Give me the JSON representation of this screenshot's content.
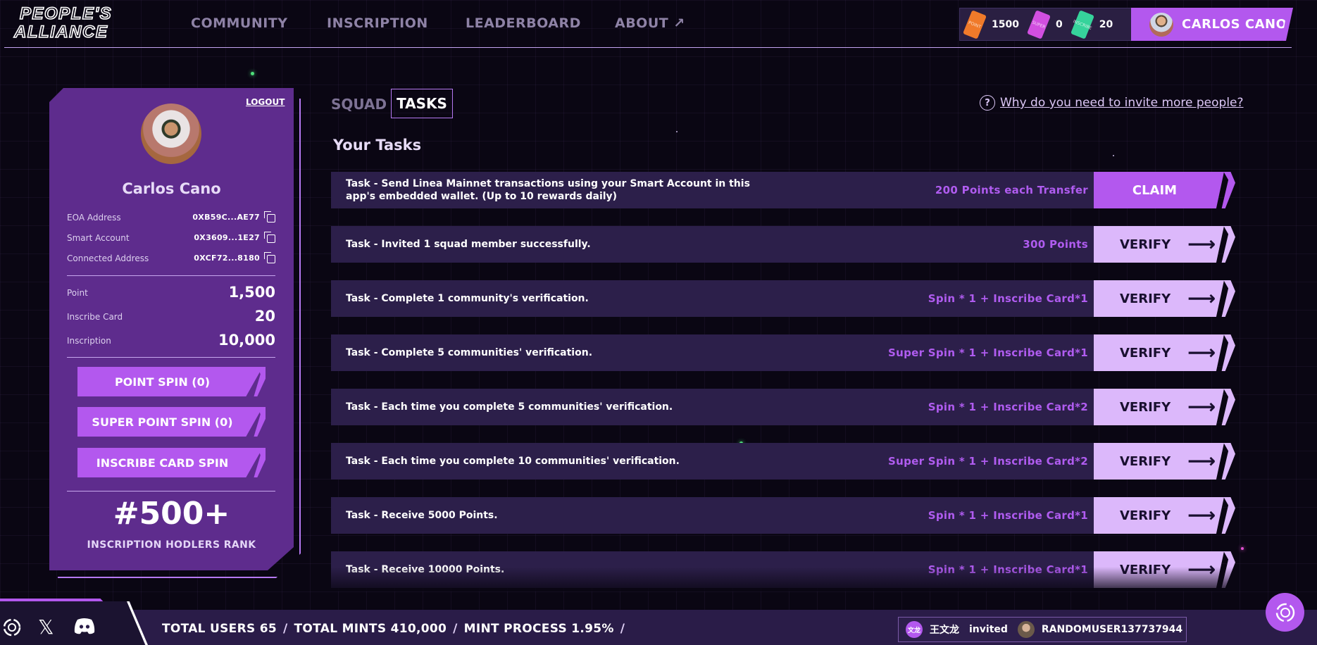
{
  "brand": {
    "logo_line1": "PEOPLE'S",
    "logo_line2": "ALLIANCE"
  },
  "nav": {
    "community": "COMMUNITY",
    "inscription": "INSCRIPTION",
    "leaderboard": "LEADERBOARD",
    "about": "ABOUT ↗"
  },
  "header_stats": {
    "point": {
      "icon": "point-ticket-icon",
      "ticket_label": "POINT",
      "value": "1500",
      "color": "#f07a2a"
    },
    "super": {
      "icon": "super-ticket-icon",
      "ticket_label": "SUPER",
      "value": "0",
      "color": "#d14fe0"
    },
    "inscribe": {
      "icon": "inscribe-ticket-icon",
      "ticket_label": "INSCRIBE",
      "value": "20",
      "color": "#36d39b"
    }
  },
  "user": {
    "name_upper": "CARLOS CANO",
    "name": "Carlos Cano"
  },
  "profile": {
    "logout": "LOGOUT",
    "addresses": [
      {
        "label": "EOA Address",
        "value": "0XB59C...AE77"
      },
      {
        "label": "Smart Account",
        "value": "0X3609...1E27"
      },
      {
        "label": "Connected Address",
        "value": "0XCF72...8180"
      }
    ],
    "stats": [
      {
        "label": "Point",
        "value": "1,500"
      },
      {
        "label": "Inscribe Card",
        "value": "20"
      },
      {
        "label": "Inscription",
        "value": "10,000"
      }
    ],
    "buttons": {
      "point_spin": "POINT SPIN (0)",
      "super_point_spin": "SUPER POINT SPIN (0)",
      "inscribe_card_spin": "INSCRIBE CARD SPIN"
    },
    "rank": "#500+",
    "rank_label": "INSCRIPTION HODLERS RANK"
  },
  "tabs": {
    "squad": "SQUAD",
    "tasks": "TASKS"
  },
  "help": {
    "icon": "question-icon",
    "text": "Why do you need to invite more people?"
  },
  "tasks_title": "Your Tasks",
  "tasks": [
    {
      "text": "Task - Send Linea Mainnet transactions using your Smart Account in this app's embedded wallet. (Up to 10 rewards daily)",
      "reward": "200 Points each Transfer",
      "action": "CLAIM"
    },
    {
      "text": "Task - Invited 1 squad member successfully.",
      "reward": "300 Points",
      "action": "VERIFY"
    },
    {
      "text": "Task - Complete 1 community's verification.",
      "reward": "Spin * 1 + Inscribe Card*1",
      "action": "VERIFY"
    },
    {
      "text": "Task - Complete 5 communities' verification.",
      "reward": "Super Spin * 1 + Inscribe Card*1",
      "action": "VERIFY"
    },
    {
      "text": "Task - Each time you complete 5 communities' verification.",
      "reward": "Spin * 1 + Inscribe Card*2",
      "action": "VERIFY"
    },
    {
      "text": "Task - Each time you complete 10 communities' verification.",
      "reward": "Super Spin * 1 + Inscribe Card*2",
      "action": "VERIFY"
    },
    {
      "text": "Task - Receive 5000 Points.",
      "reward": "Spin * 1 + Inscribe Card*1",
      "action": "VERIFY"
    },
    {
      "text": "Task - Receive 10000 Points.",
      "reward": "Spin * 1 + Inscribe Card*1",
      "action": "VERIFY"
    }
  ],
  "footer": {
    "total_users": "TOTAL USERS 65",
    "total_mints": "TOTAL MINTS 410,000",
    "mint_process": "MINT PROCESS 1.95%",
    "separator": "/",
    "ticker": {
      "inviter_avatar": "文龙",
      "inviter": "王文龙",
      "verb": "invited",
      "invitee": "RANDOMUSER137737944"
    }
  },
  "colors": {
    "accent": "#b358ee",
    "reward": "#b05cf0",
    "verify_bg": "#dcb8fb",
    "card_bg": "#5e2c8d",
    "row_bg": "#2c1f4a"
  }
}
